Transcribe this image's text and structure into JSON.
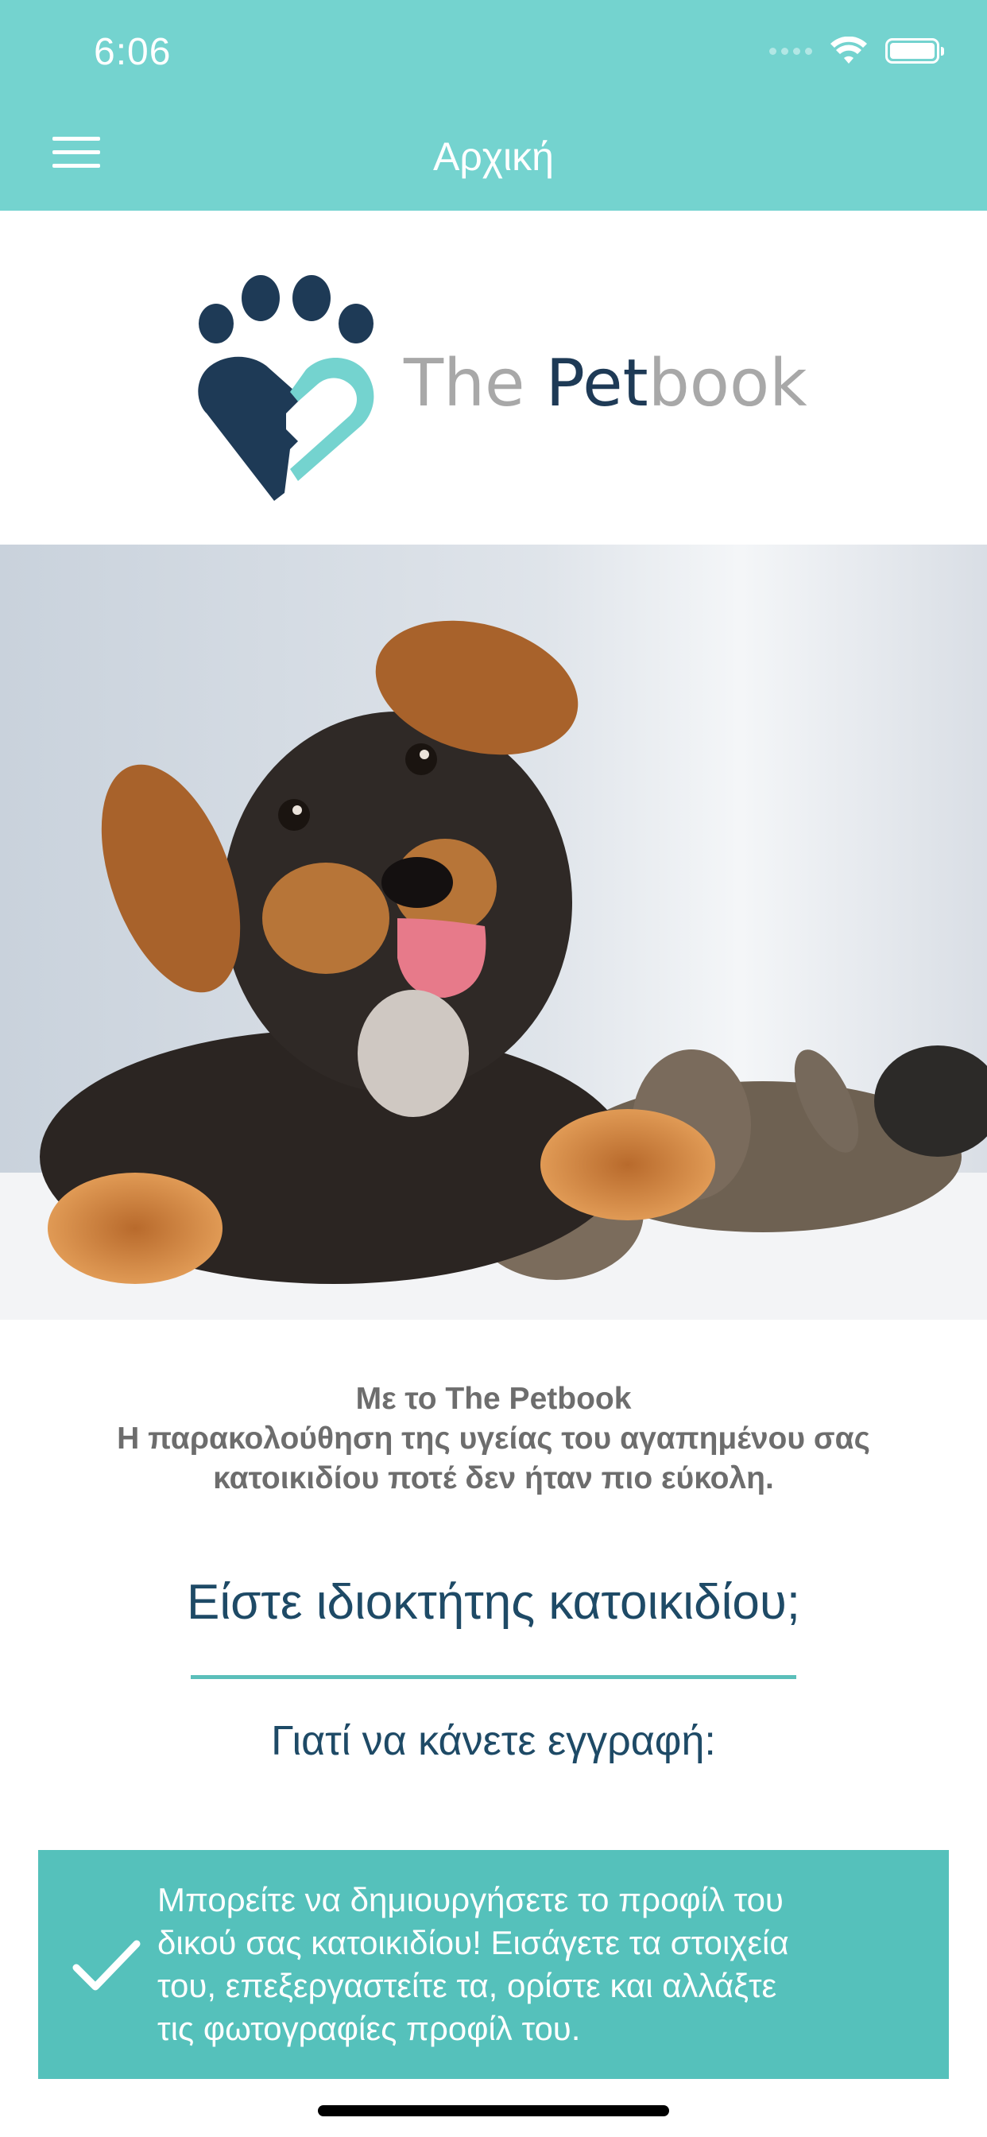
{
  "status_bar": {
    "time": "6:06"
  },
  "header": {
    "title": "Αρχική"
  },
  "logo": {
    "word1": "The ",
    "word2": "Pet",
    "word3": "book"
  },
  "hero": {
    "image": "dog-and-cat-photo"
  },
  "content": {
    "tagline_lines": [
      "Με το The Petbook",
      "Η παρακολούθηση της υγείας του αγαπημένου σας",
      "κατοικιδίου ποτέ δεν ήταν πιο εύκολη."
    ],
    "owner_question": "Είστε ιδιοκτήτης κατοικιδίου;",
    "why_register": "Γιατί να κάνετε εγγραφή:",
    "benefit_lines": [
      "Μπορείτε να δημιουργήσετε το προφίλ του",
      "δικού σας κατοικιδίου! Εισάγετε τα στοιχεία",
      "του, επεξεργαστείτε τα, ορίστε και αλλάξτε",
      "τις φωτογραφίες προφίλ του."
    ]
  },
  "colors": {
    "header": "#74d3cf",
    "brand_dark": "#1e3a56",
    "brand_teal": "#74d3cf",
    "card": "#55c1bb",
    "heading": "#1e4a66",
    "tagline": "#6d6d6d"
  },
  "icons": [
    "menu-icon",
    "wifi-icon",
    "battery-icon",
    "checkmark-icon",
    "paw-heart-logo"
  ]
}
